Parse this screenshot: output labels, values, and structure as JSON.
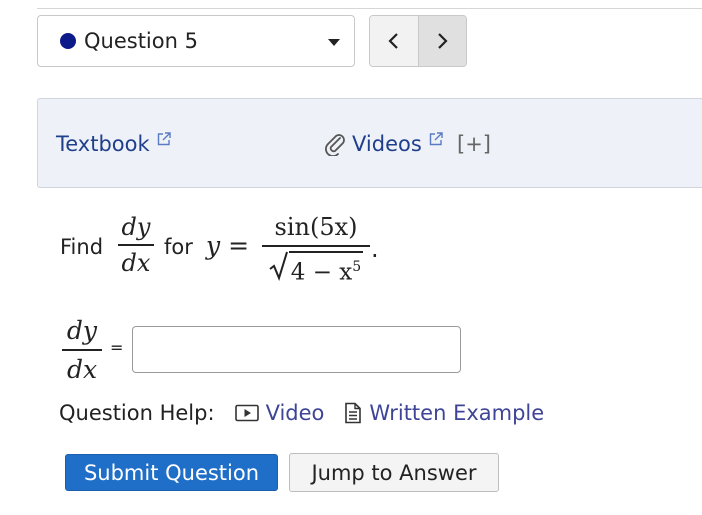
{
  "question_selector": {
    "label": "Question 5",
    "dot_color": "#0d1a8a"
  },
  "resources": {
    "textbook": "Textbook",
    "videos": "Videos",
    "more": "[+]"
  },
  "problem": {
    "find": "Find",
    "for": "for",
    "dy": "dy",
    "dx": "dx",
    "y_eq": "y =",
    "numerator": "sin(5x)",
    "radicand_base": "4 − x",
    "radicand_exp": "5",
    "period": "."
  },
  "answer": {
    "dy": "dy",
    "dx": "dx",
    "equals": "=",
    "value": "",
    "placeholder": ""
  },
  "help": {
    "label": "Question Help:",
    "video": "Video",
    "written_example": "Written Example"
  },
  "actions": {
    "submit": "Submit Question",
    "jump": "Jump to Answer"
  },
  "colors": {
    "link": "#1f3f8c",
    "help_link": "#3e4596",
    "submit_bg": "#1f6fc8",
    "panel_bg": "#eef1f7"
  }
}
